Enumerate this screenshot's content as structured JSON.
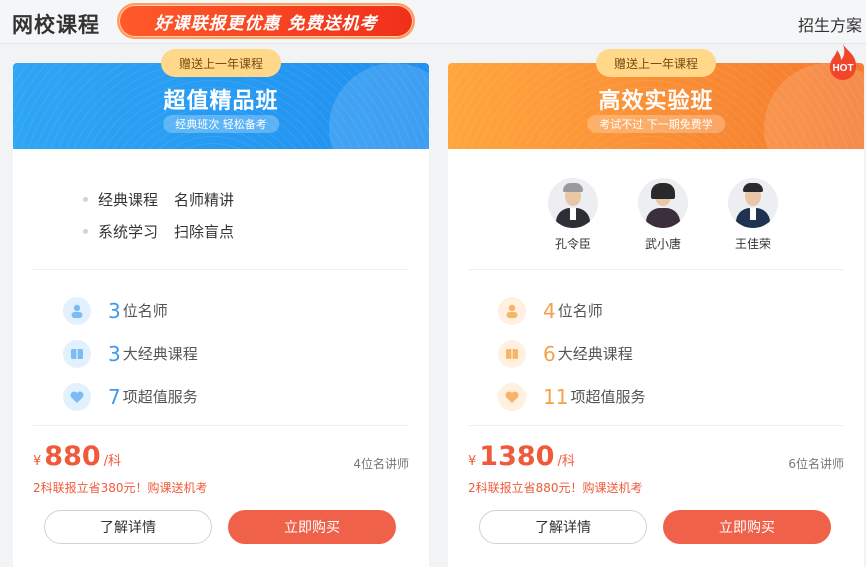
{
  "header": {
    "title": "网校课程",
    "promo_banner": "好课联报更优惠 免费送机考",
    "right_link": "招生方案"
  },
  "cards": [
    {
      "gift_tag": "赠送上一年课程",
      "name": "超值精品班",
      "subtitle": "经典班次 轻松备考",
      "theme_color": "#2a9cf3",
      "bullets": [
        [
          "经典课程",
          "名师精讲"
        ],
        [
          "系统学习",
          "扫除盲点"
        ]
      ],
      "stats": [
        {
          "num": "3",
          "text": "位名师",
          "icon": "teacher-icon"
        },
        {
          "num": "3",
          "text": "大经典课程",
          "icon": "book-icon"
        },
        {
          "num": "7",
          "text": "项超值服务",
          "icon": "heart-icon"
        }
      ],
      "price": {
        "currency": "¥",
        "value": "880",
        "unit": "/科"
      },
      "teacher_count": "4位名讲师",
      "promo_note": "2科联报立省380元！购课送机考",
      "details_button": "了解详情",
      "buy_button": "立即购买"
    },
    {
      "gift_tag": "赠送上一年课程",
      "name": "高效实验班",
      "subtitle": "考试不过 下一期免费学",
      "theme_color": "#f7882f",
      "hot_badge": "HOT",
      "teachers": [
        {
          "name": "孔令臣"
        },
        {
          "name": "武小唐"
        },
        {
          "name": "王佳荣"
        }
      ],
      "stats": [
        {
          "num": "4",
          "text": "位名师",
          "icon": "teacher-icon"
        },
        {
          "num": "6",
          "text": "大经典课程",
          "icon": "book-icon"
        },
        {
          "num": "11",
          "text": "项超值服务",
          "icon": "heart-icon"
        }
      ],
      "price": {
        "currency": "¥",
        "value": "1380",
        "unit": "/科"
      },
      "teacher_count": "6位名讲师",
      "promo_note": "2科联报立省880元！购课送机考",
      "details_button": "了解详情",
      "buy_button": "立即购买"
    }
  ]
}
